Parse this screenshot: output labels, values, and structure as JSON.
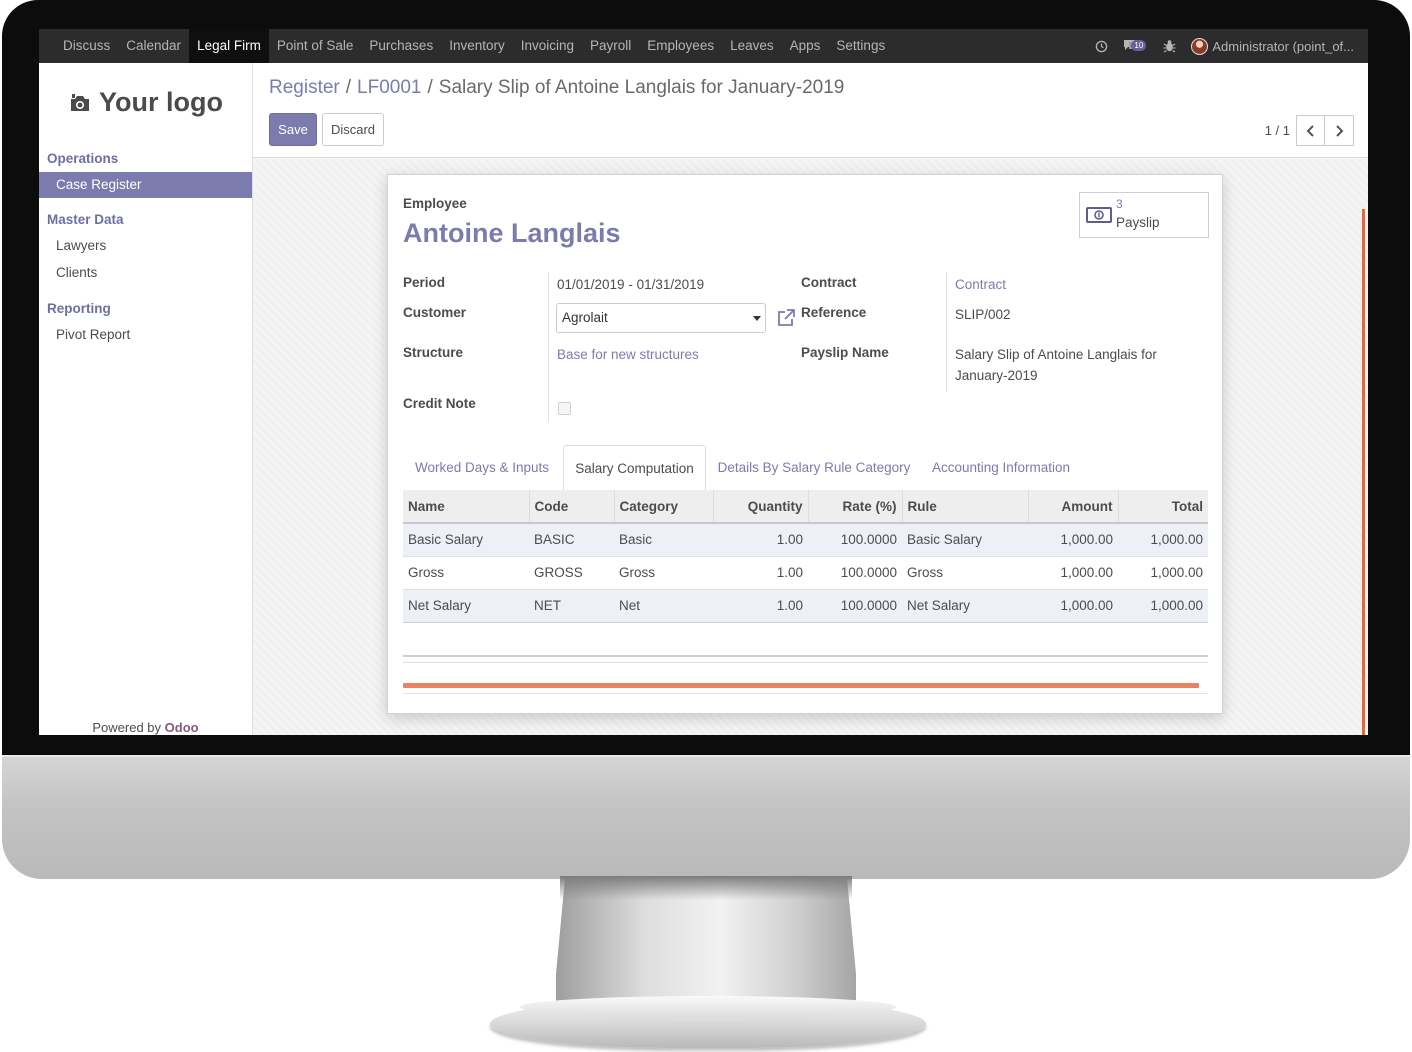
{
  "topnav": {
    "items": [
      "Discuss",
      "Calendar",
      "Legal Firm",
      "Point of Sale",
      "Purchases",
      "Inventory",
      "Invoicing",
      "Payroll",
      "Employees",
      "Leaves",
      "Apps",
      "Settings"
    ],
    "messages_count": "10",
    "user": "Administrator (point_of..."
  },
  "sidebar": {
    "logo": "Your logo",
    "sections": [
      {
        "title": "Operations",
        "items": [
          "Case Register"
        ]
      },
      {
        "title": "Master Data",
        "items": [
          "Lawyers",
          "Clients"
        ]
      },
      {
        "title": "Reporting",
        "items": [
          "Pivot Report"
        ]
      }
    ],
    "powered_prefix": "Powered by",
    "powered_brand": "Odoo"
  },
  "breadcrumb": {
    "crumb1": "Register",
    "crumb2": "LF0001",
    "current": "Salary Slip of Antoine Langlais for January-2019",
    "sep": "/"
  },
  "buttons": {
    "save": "Save",
    "discard": "Discard"
  },
  "pager": {
    "value": "1 / 1"
  },
  "form": {
    "employee_label": "Employee",
    "employee_name": "Antoine Langlais",
    "stat": {
      "count": "3",
      "label": "Payslip"
    },
    "period_label": "Period",
    "period_value": "01/01/2019 - 01/31/2019",
    "customer_label": "Customer",
    "customer_value": "Agrolait",
    "structure_label": "Structure",
    "structure_value": "Base for new structures",
    "credit_note_label": "Credit Note",
    "contract_label": "Contract",
    "contract_value": "Contract",
    "reference_label": "Reference",
    "reference_value": "SLIP/002",
    "payslip_name_label": "Payslip Name",
    "payslip_name_line1": "Salary Slip of Antoine Langlais for",
    "payslip_name_line2": "January-2019"
  },
  "tabs": [
    "Worked Days & Inputs",
    "Salary Computation",
    "Details By Salary Rule Category",
    "Accounting Information"
  ],
  "table": {
    "headers": [
      "Name",
      "Code",
      "Category",
      "Quantity",
      "Rate (%)",
      "Rule",
      "Amount",
      "Total"
    ],
    "rows": [
      [
        "Basic Salary",
        "BASIC",
        "Basic",
        "1.00",
        "100.0000",
        "Basic Salary",
        "1,000.00",
        "1,000.00"
      ],
      [
        "Gross",
        "GROSS",
        "Gross",
        "1.00",
        "100.0000",
        "Gross",
        "1,000.00",
        "1,000.00"
      ],
      [
        "Net Salary",
        "NET",
        "Net",
        "1.00",
        "100.0000",
        "Net Salary",
        "1,000.00",
        "1,000.00"
      ]
    ]
  },
  "colors": {
    "accent": "#7c7bad",
    "topbar": "#2c2c2c",
    "brand": "#875a7b",
    "progress": "#e8825f"
  }
}
